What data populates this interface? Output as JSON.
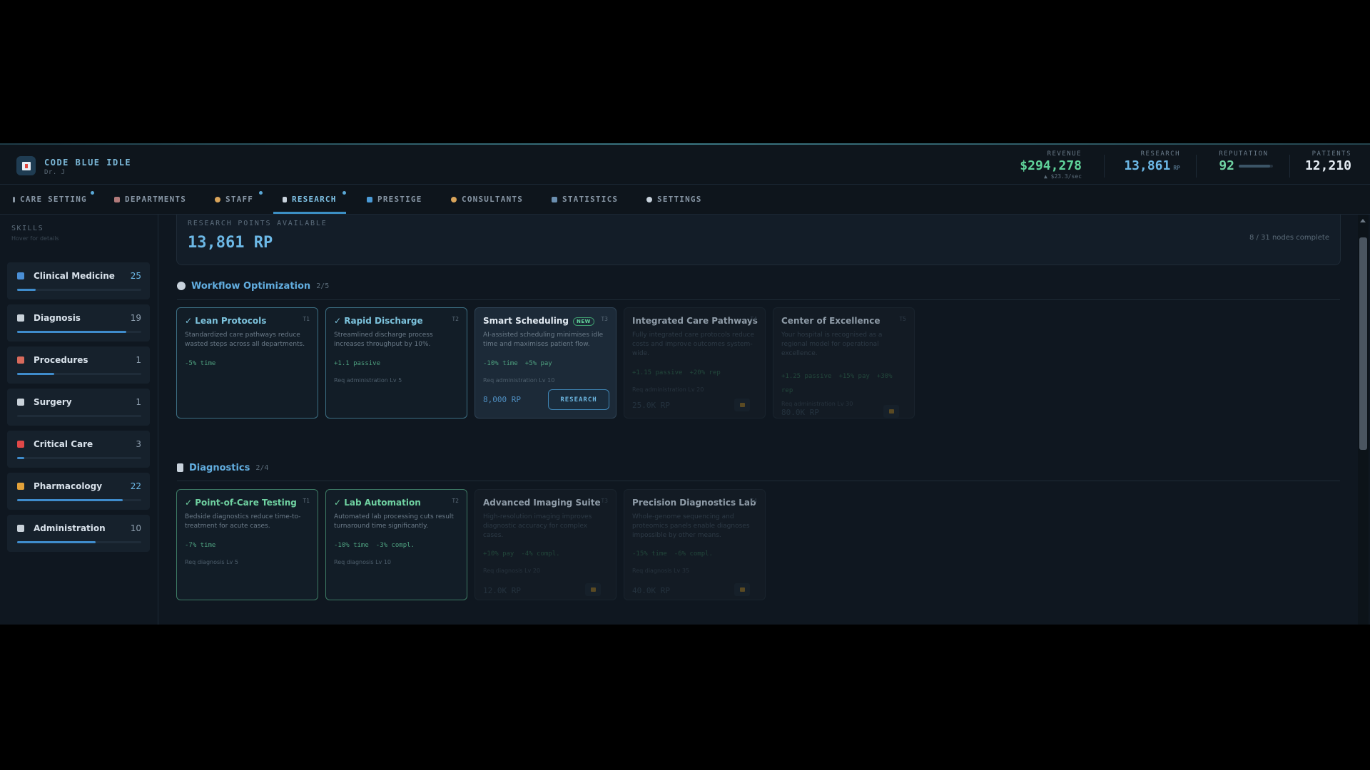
{
  "app": {
    "title": "CODE BLUE IDLE",
    "subtitle": "Dr. J"
  },
  "stats": {
    "revenue": {
      "label": "REVENUE",
      "value": "$294,278",
      "sub": "▲ $23.3/sec"
    },
    "research": {
      "label": "RESEARCH",
      "value": "13,861",
      "unit": "RP"
    },
    "reputation": {
      "label": "REPUTATION",
      "value": "92",
      "bar_fraction": 0.92
    },
    "patients": {
      "label": "PATIENTS",
      "value": "12,210"
    }
  },
  "tabs": [
    {
      "label": "CARE SETTING",
      "icon": "hospital-bed-icon",
      "dot": true
    },
    {
      "label": "DEPARTMENTS",
      "icon": "building-icon",
      "dot": false
    },
    {
      "label": "STAFF",
      "icon": "person-icon",
      "dot": true
    },
    {
      "label": "RESEARCH",
      "icon": "flask-icon",
      "dot": true,
      "active": true
    },
    {
      "label": "PRESTIGE",
      "icon": "star-icon",
      "dot": false
    },
    {
      "label": "CONSULTANTS",
      "icon": "consultant-icon",
      "dot": false
    },
    {
      "label": "STATISTICS",
      "icon": "chart-icon",
      "dot": false
    },
    {
      "label": "SETTINGS",
      "icon": "gear-icon",
      "dot": false
    }
  ],
  "sidebar": {
    "header": "SKILLS",
    "subheader": "Hover for details",
    "skills": [
      {
        "name": "Clinical Medicine",
        "level": "25",
        "progress": 0.15,
        "color": "#4a8fd6"
      },
      {
        "name": "Diagnosis",
        "level": "19",
        "progress": 0.88,
        "color": "#c9d2da"
      },
      {
        "name": "Procedures",
        "level": "1",
        "progress": 0.3,
        "color": "#d86a5c"
      },
      {
        "name": "Surgery",
        "level": "1",
        "progress": 0.0,
        "color": "#c9d2da"
      },
      {
        "name": "Critical Care",
        "level": "3",
        "progress": 0.06,
        "color": "#e04848"
      },
      {
        "name": "Pharmacology",
        "level": "22",
        "progress": 0.85,
        "color": "#e3a23a"
      },
      {
        "name": "Administration",
        "level": "10",
        "progress": 0.63,
        "color": "#c9d2da"
      }
    ]
  },
  "research": {
    "points_label": "RESEARCH POINTS AVAILABLE",
    "points_value": "13,861 RP",
    "nodes_complete": "8 / 31 nodes complete"
  },
  "sections": [
    {
      "title": "Workflow Optimization",
      "count": "2/5",
      "icon": "gear-icon",
      "nodes": [
        {
          "title": "✓ Lean Protocols",
          "tier": "T1",
          "state": "done",
          "desc": "Standardized care pathways reduce wasted steps across all departments.",
          "effects": [
            "-5% time"
          ],
          "req": ""
        },
        {
          "title": "✓ Rapid Discharge",
          "tier": "T2",
          "state": "done",
          "desc": "Streamlined discharge process increases throughput by 10%.",
          "effects": [
            "+1.1 passive"
          ],
          "req": "Req administration Lv 5"
        },
        {
          "title": "Smart Scheduling",
          "badge": "NEW",
          "tier": "T3",
          "state": "available",
          "desc": "AI-assisted scheduling minimises idle time and maximises patient flow.",
          "effects": [
            "-10% time",
            "+5% pay"
          ],
          "req": "Req administration Lv 10",
          "cost": "8,000 RP",
          "button": "RESEARCH"
        },
        {
          "title": "Integrated Care Pathways",
          "tier": "T4",
          "state": "locked",
          "desc": "Fully integrated care protocols reduce costs and improve outcomes system-wide.",
          "effects": [
            "+1.15 passive",
            "+20% rep"
          ],
          "req": "Req administration Lv 20",
          "cost": "25.0K RP"
        },
        {
          "title": "Center of Excellence",
          "tier": "T5",
          "state": "locked",
          "desc": "Your hospital is recognised as a regional model for operational excellence.",
          "effects": [
            "+1.25 passive",
            "+15% pay",
            "+30% rep"
          ],
          "req": "Req administration Lv 30",
          "cost": "80.0K RP"
        }
      ]
    },
    {
      "title": "Diagnostics",
      "count": "2/4",
      "icon": "flask-icon",
      "nodes": [
        {
          "title": "✓ Point-of-Care Testing",
          "tier": "T1",
          "state": "done-green",
          "desc": "Bedside diagnostics reduce time-to-treatment for acute cases.",
          "effects": [
            "-7% time"
          ],
          "req": "Req diagnosis Lv 5"
        },
        {
          "title": "✓ Lab Automation",
          "tier": "T2",
          "state": "done-green",
          "desc": "Automated lab processing cuts result turnaround time significantly.",
          "effects": [
            "-10% time",
            "-3% compl."
          ],
          "req": "Req diagnosis Lv 10"
        },
        {
          "title": "Advanced Imaging Suite",
          "tier": "T3",
          "state": "locked",
          "desc": "High-resolution imaging improves diagnostic accuracy for complex cases.",
          "effects": [
            "+10% pay",
            "-4% compl."
          ],
          "req": "Req diagnosis Lv 20",
          "cost": "12.0K RP"
        },
        {
          "title": "Precision Diagnostics Lab",
          "tier": "T4",
          "state": "locked",
          "desc": "Whole-genome sequencing and proteomics panels enable diagnoses impossible by other means.",
          "effects": [
            "-15% time",
            "-6% compl."
          ],
          "req": "Req diagnosis Lv 35",
          "cost": "40.0K RP"
        }
      ]
    }
  ],
  "colors": {
    "accent": "#6cb8e6",
    "done_border": "#3c6f83",
    "green": "#6fd1a1",
    "revenue": "#5fd39a"
  }
}
